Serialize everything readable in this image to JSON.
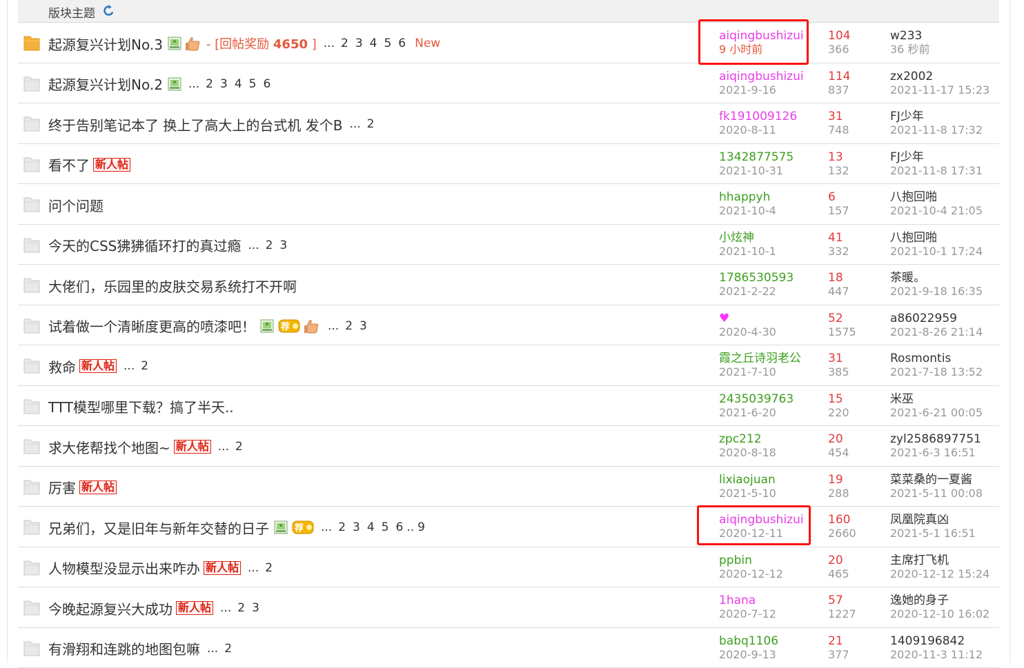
{
  "section": {
    "title": "版块主题"
  },
  "colors": {
    "pink": "#e83de8",
    "green": "#3c9f1e",
    "red": "#e4393c",
    "orange": "#e4593c",
    "highlight": "#ff1010"
  },
  "threads": [
    {
      "title": "起源复兴计划No.3",
      "hot": true,
      "img": true,
      "thumb": true,
      "reward": {
        "prefix": "- [回帖奖励",
        "amount": "4650",
        "suffix": "]"
      },
      "pages": [
        "2",
        "3",
        "4",
        "5",
        "6"
      ],
      "new_tag": "New",
      "author": "aiqingbushizui",
      "author_color": "pink",
      "date": "9 小时前",
      "date_color": "orange",
      "replies": "104",
      "views": "366",
      "last_user": "w233",
      "last_time": "36 秒前"
    },
    {
      "title": "起源复兴计划No.2",
      "img": true,
      "pages": [
        "2",
        "3",
        "4",
        "5",
        "6"
      ],
      "author": "aiqingbushizui",
      "author_color": "pink",
      "date": "2021-9-16",
      "replies": "114",
      "views": "837",
      "last_user": "zx2002",
      "last_time": "2021-11-17 15:23"
    },
    {
      "title": "终于告别笔记本了 换上了高大上的台式机 发个B",
      "pages": [
        "2"
      ],
      "author": "fk191009126",
      "author_color": "pink",
      "date": "2020-8-11",
      "replies": "31",
      "views": "748",
      "last_user": "FJ少年",
      "last_time": "2021-11-8 17:32"
    },
    {
      "title": "看不了",
      "newbie": "新人帖",
      "author": "1342877575",
      "author_color": "green",
      "date": "2021-10-31",
      "replies": "13",
      "views": "132",
      "last_user": "FJ少年",
      "last_time": "2021-11-8 17:31"
    },
    {
      "title": "问个问题",
      "author": "hhappyh",
      "author_color": "green",
      "date": "2021-10-4",
      "replies": "6",
      "views": "157",
      "last_user": "八抱回啪",
      "last_time": "2021-10-4 21:05"
    },
    {
      "title": "今天的CSS狒狒循环打的真过瘾",
      "pages": [
        "2",
        "3"
      ],
      "author": "小炫神",
      "author_color": "green",
      "date": "2021-10-1",
      "replies": "41",
      "views": "332",
      "last_user": "八抱回啪",
      "last_time": "2021-10-1 17:24"
    },
    {
      "title": "大佬们，乐园里的皮肤交易系统打不开啊",
      "author": "1786530593",
      "author_color": "green",
      "date": "2021-2-22",
      "replies": "18",
      "views": "447",
      "last_user": "茶暖。",
      "last_time": "2021-9-18 16:35"
    },
    {
      "title": "试着做一个清晰度更高的喷漆吧！",
      "img": true,
      "rec": true,
      "thumb": true,
      "pages": [
        "2",
        "3"
      ],
      "author_heart": "♥",
      "author": "",
      "date": "2020-4-30",
      "replies": "52",
      "views": "1575",
      "last_user": "a86022959",
      "last_time": "2021-8-26 21:14"
    },
    {
      "title": "救命",
      "newbie": "新人帖",
      "pages": [
        "2"
      ],
      "author": "霞之丘诗羽老公",
      "author_color": "green",
      "date": "2021-7-10",
      "replies": "31",
      "views": "385",
      "last_user": "Rosmontis",
      "last_time": "2021-7-18 13:52"
    },
    {
      "title": "TTT模型哪里下载？搞了半天..",
      "author": "2435039763",
      "author_color": "green",
      "date": "2021-6-20",
      "replies": "15",
      "views": "220",
      "last_user": "米巫",
      "last_time": "2021-6-21 00:05"
    },
    {
      "title": "求大佬帮找个地图~",
      "newbie": "新人帖",
      "pages": [
        "2"
      ],
      "author": "zpc212",
      "author_color": "green",
      "date": "2020-8-18",
      "replies": "20",
      "views": "454",
      "last_user": "zyl2586897751",
      "last_time": "2021-6-3 16:51"
    },
    {
      "title": "厉害",
      "newbie": "新人帖",
      "author": "lixiaojuan",
      "author_color": "green",
      "date": "2021-5-10",
      "replies": "19",
      "views": "288",
      "last_user": "菜菜桑的一夏酱",
      "last_time": "2021-5-11 00:08"
    },
    {
      "title": "兄弟们，又是旧年与新年交替的日子",
      "img": true,
      "rec": true,
      "pages": [
        "2",
        "3",
        "4",
        "5",
        "6"
      ],
      "last_page": "9",
      "author": "aiqingbushizui",
      "author_color": "pink",
      "date": "2020-12-11",
      "replies": "160",
      "views": "2660",
      "last_user": "凤凰院真凶",
      "last_time": "2021-5-1 16:51"
    },
    {
      "title": "人物模型没显示出来咋办",
      "newbie": "新人帖",
      "pages": [
        "2"
      ],
      "author": "ppbin",
      "author_color": "green",
      "date": "2020-12-12",
      "replies": "20",
      "views": "465",
      "last_user": "主席打飞机",
      "last_time": "2020-12-12 15:24"
    },
    {
      "title": "今晚起源复兴大成功",
      "newbie": "新人帖",
      "pages": [
        "2",
        "3"
      ],
      "author": "1hana",
      "author_color": "pink",
      "date": "2020-7-12",
      "replies": "57",
      "views": "1227",
      "last_user": "逸她的身子",
      "last_time": "2020-12-10 16:02"
    },
    {
      "title": "有滑翔和连跳的地图包嘛",
      "pages": [
        "2"
      ],
      "author": "babq1106",
      "author_color": "green",
      "date": "2020-9-13",
      "replies": "21",
      "views": "377",
      "last_user": "1409196842",
      "last_time": "2020-11-3 11:12"
    }
  ]
}
